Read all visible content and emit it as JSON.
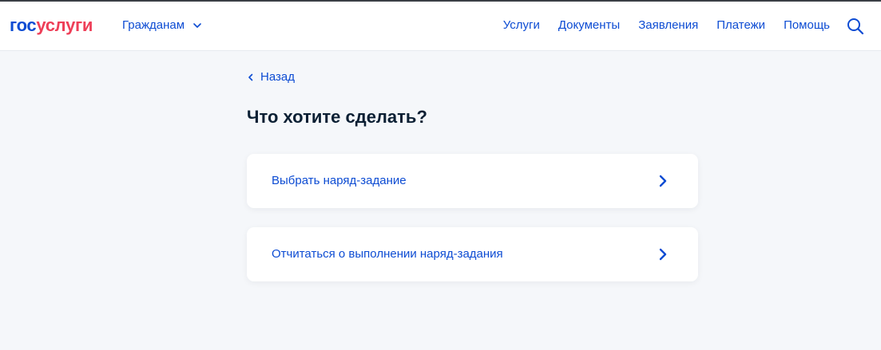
{
  "colors": {
    "accent": "#0d4cd3",
    "brand_red": "#ee3f58",
    "background": "#f5f7fa",
    "text_dark": "#0b1f33"
  },
  "header": {
    "logo": {
      "part1": "гос",
      "part2": "услуги"
    },
    "audience_label": "Гражданам",
    "audience_icon": "chevron-down-icon",
    "nav": [
      "Услуги",
      "Документы",
      "Заявления",
      "Платежи",
      "Помощь"
    ],
    "search_icon": "search-icon"
  },
  "main": {
    "back_label": "Назад",
    "back_icon": "chevron-left-icon",
    "title": "Что хотите сделать?",
    "options": [
      {
        "label": "Выбрать наряд-задание",
        "icon": "chevron-right-icon"
      },
      {
        "label": "Отчитаться о выполнении наряд-задания",
        "icon": "chevron-right-icon"
      }
    ]
  }
}
